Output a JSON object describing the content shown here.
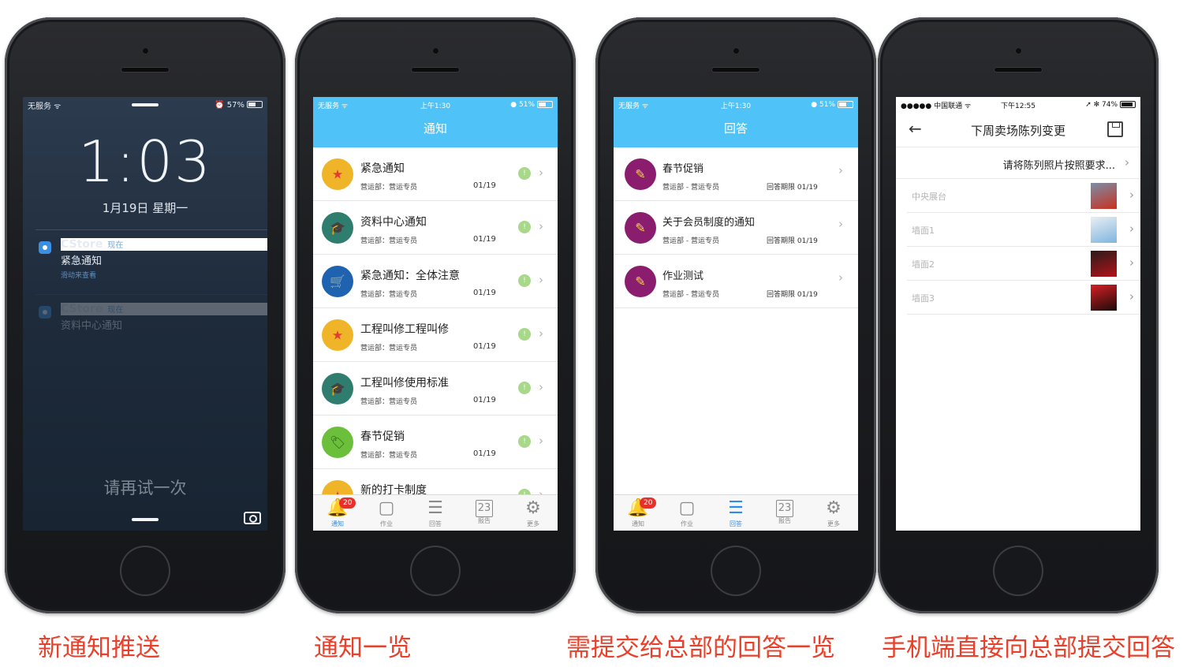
{
  "captions": [
    "新通知推送",
    "通知一览",
    "需提交给总部的回答一览",
    "手机端直接向总部提交回答"
  ],
  "lock": {
    "carrier": "无服务 ᯤ",
    "battery": "⏰ 57%",
    "time": "1:03",
    "date": "1月19日 星期一",
    "notifications": [
      {
        "app": "CStore",
        "when": "现在",
        "message": "紧急通知",
        "hint": "滑动来查看"
      },
      {
        "app": "CStore",
        "when": "现在",
        "message": "资料中心通知",
        "hint": ""
      }
    ],
    "retry": "请再试一次"
  },
  "notice": {
    "status": {
      "left": "无服务 ᯤ",
      "time": "上午1:30",
      "right": "● 51%"
    },
    "title": "通知",
    "items": [
      {
        "title": "紧急通知",
        "sub": "营运部：营运专员",
        "date": "01/19",
        "icon": "star-icon",
        "icon_bg": "#f0b429",
        "icon_glyph": "★",
        "glyph_color": "#e53935"
      },
      {
        "title": "资料中心通知",
        "sub": "营运部：营运专员",
        "date": "01/19",
        "icon": "graduation-cap-icon",
        "icon_bg": "#2f7d6e",
        "icon_glyph": "🎓",
        "glyph_color": "#f3c623"
      },
      {
        "title": "紧急通知：全体注意",
        "sub": "营运部：营运专员",
        "date": "01/19",
        "icon": "cart-icon",
        "icon_bg": "#1e62b0",
        "icon_glyph": "🛒",
        "glyph_color": "#f3c623"
      },
      {
        "title": "工程叫修工程叫修",
        "sub": "营运部：营运专员",
        "date": "01/19",
        "icon": "star-icon",
        "icon_bg": "#f0b429",
        "icon_glyph": "★",
        "glyph_color": "#e53935"
      },
      {
        "title": "工程叫修使用标准",
        "sub": "营运部：营运专员",
        "date": "01/19",
        "icon": "graduation-cap-icon",
        "icon_bg": "#2f7d6e",
        "icon_glyph": "🎓",
        "glyph_color": "#f3c623"
      },
      {
        "title": "春节促销",
        "sub": "营运部：营运专员",
        "date": "01/19",
        "icon": "ticket-icon",
        "icon_bg": "#6cbf3a",
        "icon_glyph": "🏷",
        "glyph_color": "#2e5f1e"
      },
      {
        "title": "新的打卡制度",
        "sub": "",
        "date": "",
        "icon": "star-icon",
        "icon_bg": "#f0b429",
        "icon_glyph": "★",
        "glyph_color": "#e53935"
      }
    ],
    "unread_mark": "!"
  },
  "tabs": [
    {
      "label": "通知",
      "icon": "bell-icon",
      "glyph": "🔔"
    },
    {
      "label": "作业",
      "icon": "task-icon",
      "glyph": "▢"
    },
    {
      "label": "回答",
      "icon": "answer-icon",
      "glyph": "☰"
    },
    {
      "label": "报告",
      "icon": "calendar-icon",
      "glyph": "23"
    },
    {
      "label": "更多",
      "icon": "gear-icon",
      "glyph": "⚙"
    }
  ],
  "badge": "20",
  "answers": {
    "status": {
      "left": "无服务 ᯤ",
      "time": "上午1:30",
      "right": "● 51%"
    },
    "title": "回答",
    "items": [
      {
        "title": "春节促销",
        "sub": "营运部 - 营运专员",
        "deadline": "回答期限 01/19"
      },
      {
        "title": "关于会员制度的通知",
        "sub": "营运部 - 营运专员",
        "deadline": "回答期限 01/19"
      },
      {
        "title": "作业测试",
        "sub": "营运部 - 营运专员",
        "deadline": "回答期限 01/19"
      }
    ]
  },
  "submit": {
    "status": {
      "left": "●●●●● 中国联通 ᯤ",
      "time": "下午12:55",
      "right": "➚ ✻ 74%"
    },
    "back": "←",
    "title": "下周卖场陈列变更",
    "requirement": "请将陈列照片按照要求...",
    "items": [
      {
        "label": "中央展台",
        "thumb": [
          "#c9301e",
          "#7a8ea8"
        ]
      },
      {
        "label": "墙面1",
        "thumb": [
          "#7fb5de",
          "#e9eef3"
        ]
      },
      {
        "label": "墙面2",
        "thumb": [
          "#b3121a",
          "#2a1c1a"
        ]
      },
      {
        "label": "墙面3",
        "thumb": [
          "#1a0b0a",
          "#d61f24"
        ]
      }
    ]
  },
  "colors": {
    "accent": "#4fc3f7",
    "caption": "#e8402a",
    "tab_active": "#2e8de6"
  }
}
